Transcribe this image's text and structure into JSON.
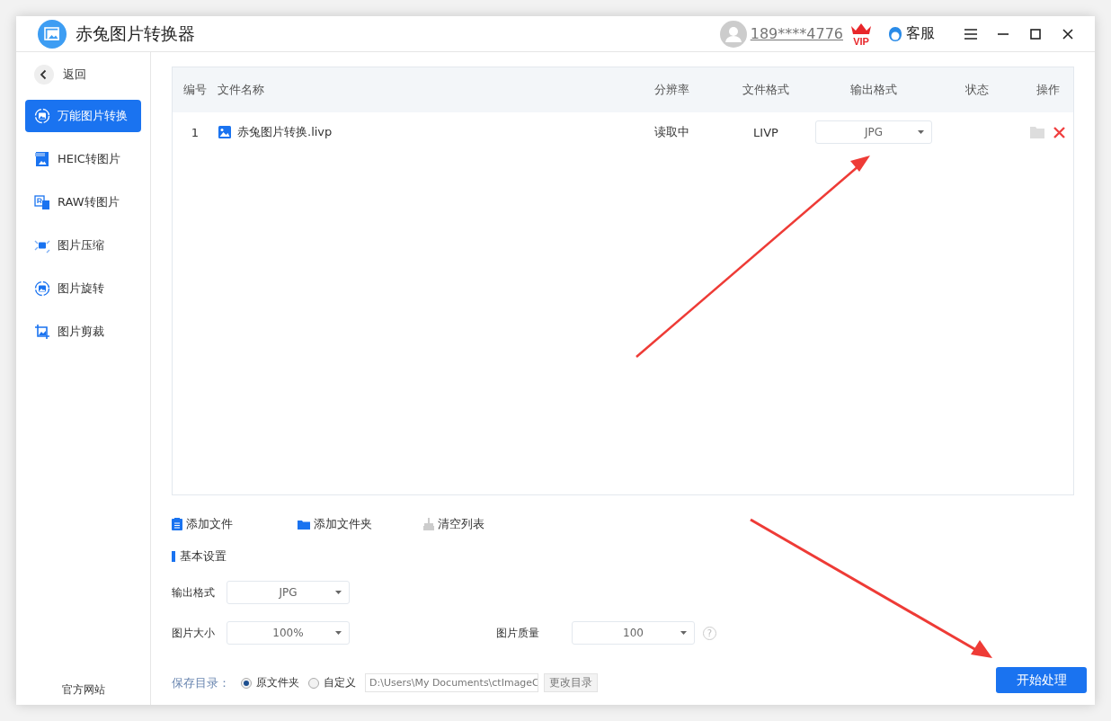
{
  "window": {
    "title": "赤兔图片转换器"
  },
  "header": {
    "account": "189****4776",
    "badge": "VIP",
    "support": "客服"
  },
  "sidebar": {
    "back": "返回",
    "items": [
      {
        "label": "万能图片转换",
        "kind": "convert",
        "selected": true
      },
      {
        "label": "HEIC转图片",
        "kind": "heic",
        "selected": false
      },
      {
        "label": "RAW转图片",
        "kind": "raw",
        "selected": false
      },
      {
        "label": "图片压缩",
        "kind": "compress",
        "selected": false
      },
      {
        "label": "图片旋转",
        "kind": "rotate",
        "selected": false
      },
      {
        "label": "图片剪裁",
        "kind": "crop",
        "selected": false
      }
    ],
    "footer": "官方网站"
  },
  "table": {
    "columns": [
      "编号",
      "文件名称",
      "分辨率",
      "文件格式",
      "输出格式",
      "状态",
      "操作"
    ],
    "rows": [
      {
        "number": "1",
        "name": "赤兔图片转换.livp",
        "resolution": "读取中",
        "format": "LIVP",
        "output": "JPG"
      }
    ]
  },
  "actions": [
    {
      "label": "添加文件",
      "kind": "file"
    },
    {
      "label": "添加文件夹",
      "kind": "folder"
    },
    {
      "label": "清空列表",
      "kind": "clear"
    }
  ],
  "settings": {
    "title": "基本设置",
    "help": "?",
    "output_format": {
      "label": "输出格式",
      "value": "JPG"
    },
    "size": {
      "label": "图片大小",
      "value": "100%"
    },
    "quality": {
      "label": "图片质量",
      "value": "100"
    }
  },
  "save": {
    "label": "保存目录：",
    "options": [
      {
        "label": "原文件夹",
        "selected": true
      },
      {
        "label": "自定义",
        "selected": false
      }
    ],
    "path": "D:\\Users\\My Documents\\ctImageC",
    "change": "更改目录"
  },
  "start": "开始处理"
}
